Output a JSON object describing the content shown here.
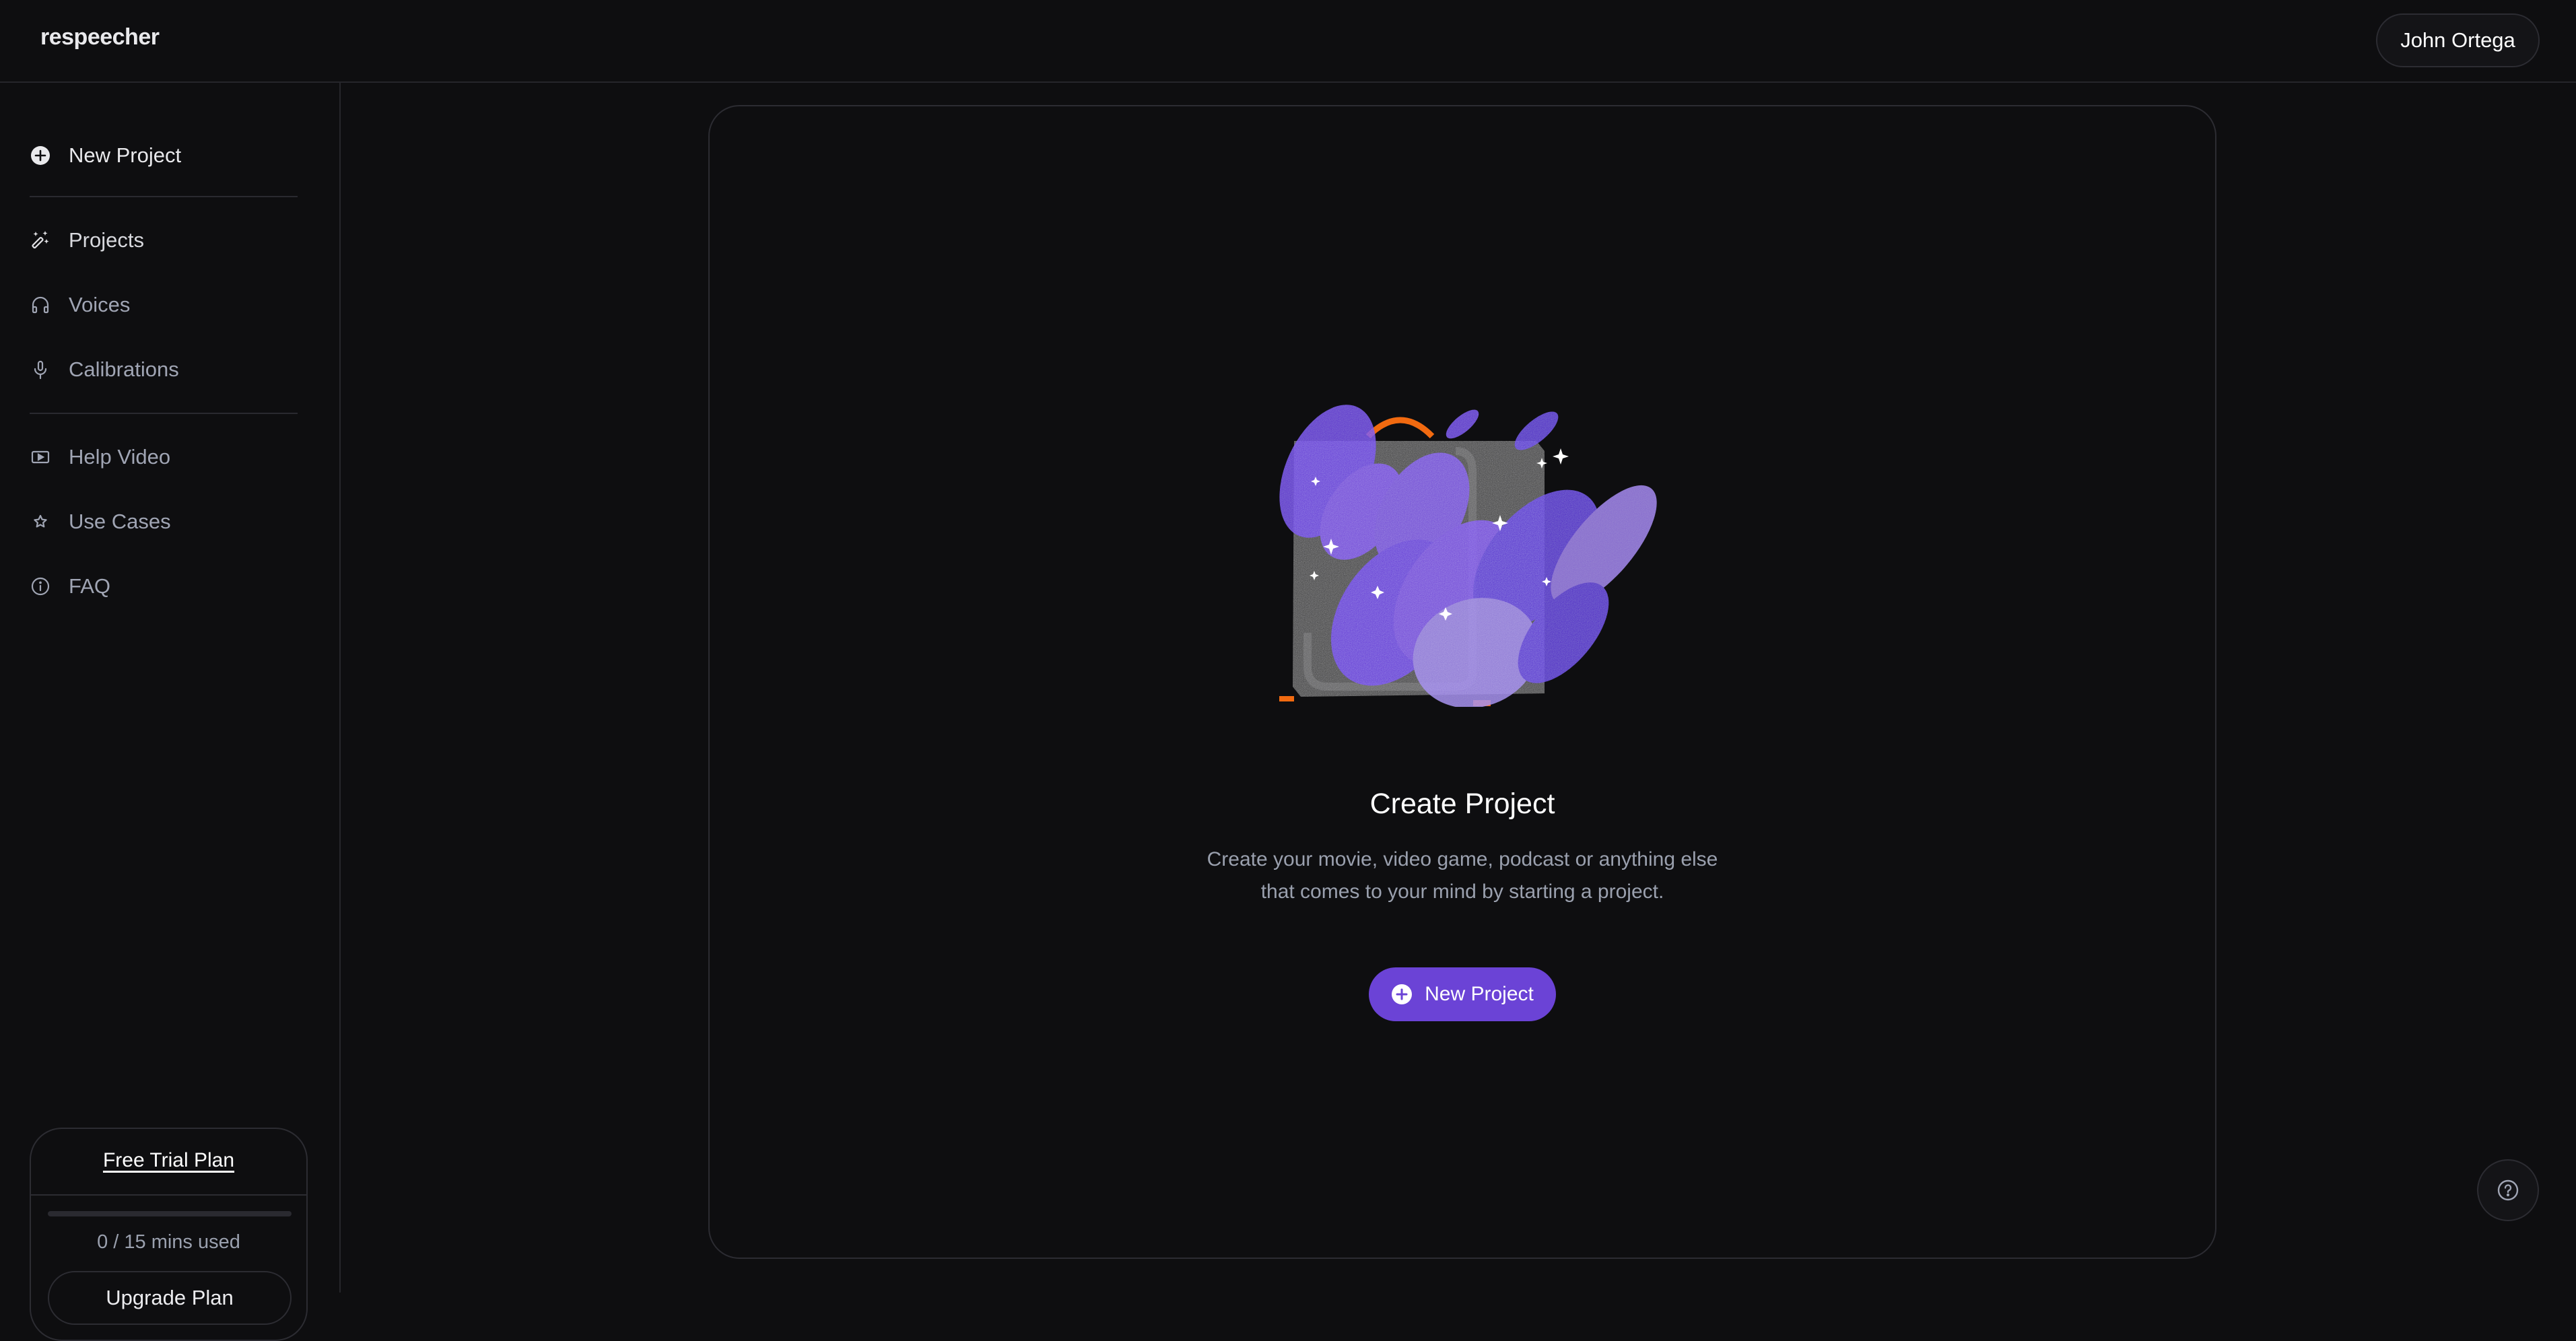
{
  "app": {
    "logo": "respeecher"
  },
  "header": {
    "user_name": "John Ortega"
  },
  "sidebar": {
    "new_project": {
      "label": "New Project",
      "icon": "plus-circle-icon"
    },
    "nav": [
      {
        "label": "Projects",
        "icon": "magic-wand-icon",
        "active": true
      },
      {
        "label": "Voices",
        "icon": "headphones-icon"
      },
      {
        "label": "Calibrations",
        "icon": "microphone-icon"
      }
    ],
    "secondary": [
      {
        "label": "Help Video",
        "icon": "play-video-icon"
      },
      {
        "label": "Use Cases",
        "icon": "star-icon"
      },
      {
        "label": "FAQ",
        "icon": "info-icon"
      }
    ],
    "plan": {
      "title": "Free Trial Plan",
      "used_minutes": 0,
      "total_minutes": 15,
      "usage_fraction": 0,
      "usage_text": "0 / 15 mins used",
      "upgrade_label": "Upgrade Plan"
    }
  },
  "main": {
    "illustration": "suitcase-with-purple-flames-illustration",
    "title": "Create Project",
    "description_line1": "Create your movie, video game, podcast or anything else",
    "description_line2": "that comes to your mind by starting a project.",
    "cta_label": "New Project"
  },
  "help_button": {
    "icon": "question-circle-icon"
  },
  "colors": {
    "background": "#0e0e10",
    "border": "#2c2c32",
    "accent": "#6b43d6",
    "muted_text": "#9aa0ae",
    "illustration_orange": "#f26a10"
  }
}
